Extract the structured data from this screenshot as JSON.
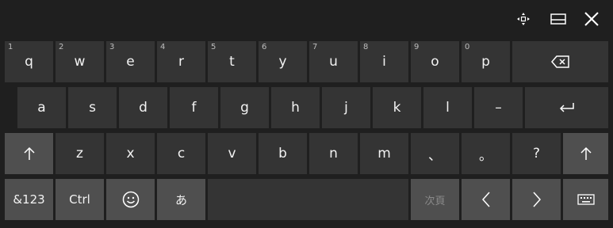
{
  "topbar": {
    "icons": [
      "move-handle-icon",
      "dock-keyboard-icon",
      "close-icon"
    ]
  },
  "rows": {
    "row1": [
      {
        "label": "q",
        "num": "1"
      },
      {
        "label": "w",
        "num": "2"
      },
      {
        "label": "e",
        "num": "3"
      },
      {
        "label": "r",
        "num": "4"
      },
      {
        "label": "t",
        "num": "5"
      },
      {
        "label": "y",
        "num": "6"
      },
      {
        "label": "u",
        "num": "7"
      },
      {
        "label": "i",
        "num": "8"
      },
      {
        "label": "o",
        "num": "9"
      },
      {
        "label": "p",
        "num": "0"
      }
    ],
    "row2": [
      {
        "label": "a"
      },
      {
        "label": "s"
      },
      {
        "label": "d"
      },
      {
        "label": "f"
      },
      {
        "label": "g"
      },
      {
        "label": "h"
      },
      {
        "label": "j"
      },
      {
        "label": "k"
      },
      {
        "label": "l"
      },
      {
        "label": "–"
      }
    ],
    "row3": [
      {
        "label": "z"
      },
      {
        "label": "x"
      },
      {
        "label": "c"
      },
      {
        "label": "v"
      },
      {
        "label": "b"
      },
      {
        "label": "n"
      },
      {
        "label": "m"
      },
      {
        "label": "、"
      },
      {
        "label": "。"
      },
      {
        "label": "?"
      }
    ]
  },
  "special": {
    "numbers_label": "&123",
    "ctrl_label": "Ctrl",
    "ime_label": "あ",
    "next_page_label": "次頁"
  },
  "colors": {
    "background": "#1f1f1f",
    "key": "#343434",
    "key_light": "#4f4f4f",
    "text": "#f2f2f2",
    "disabled_text": "#8a8a8a"
  }
}
